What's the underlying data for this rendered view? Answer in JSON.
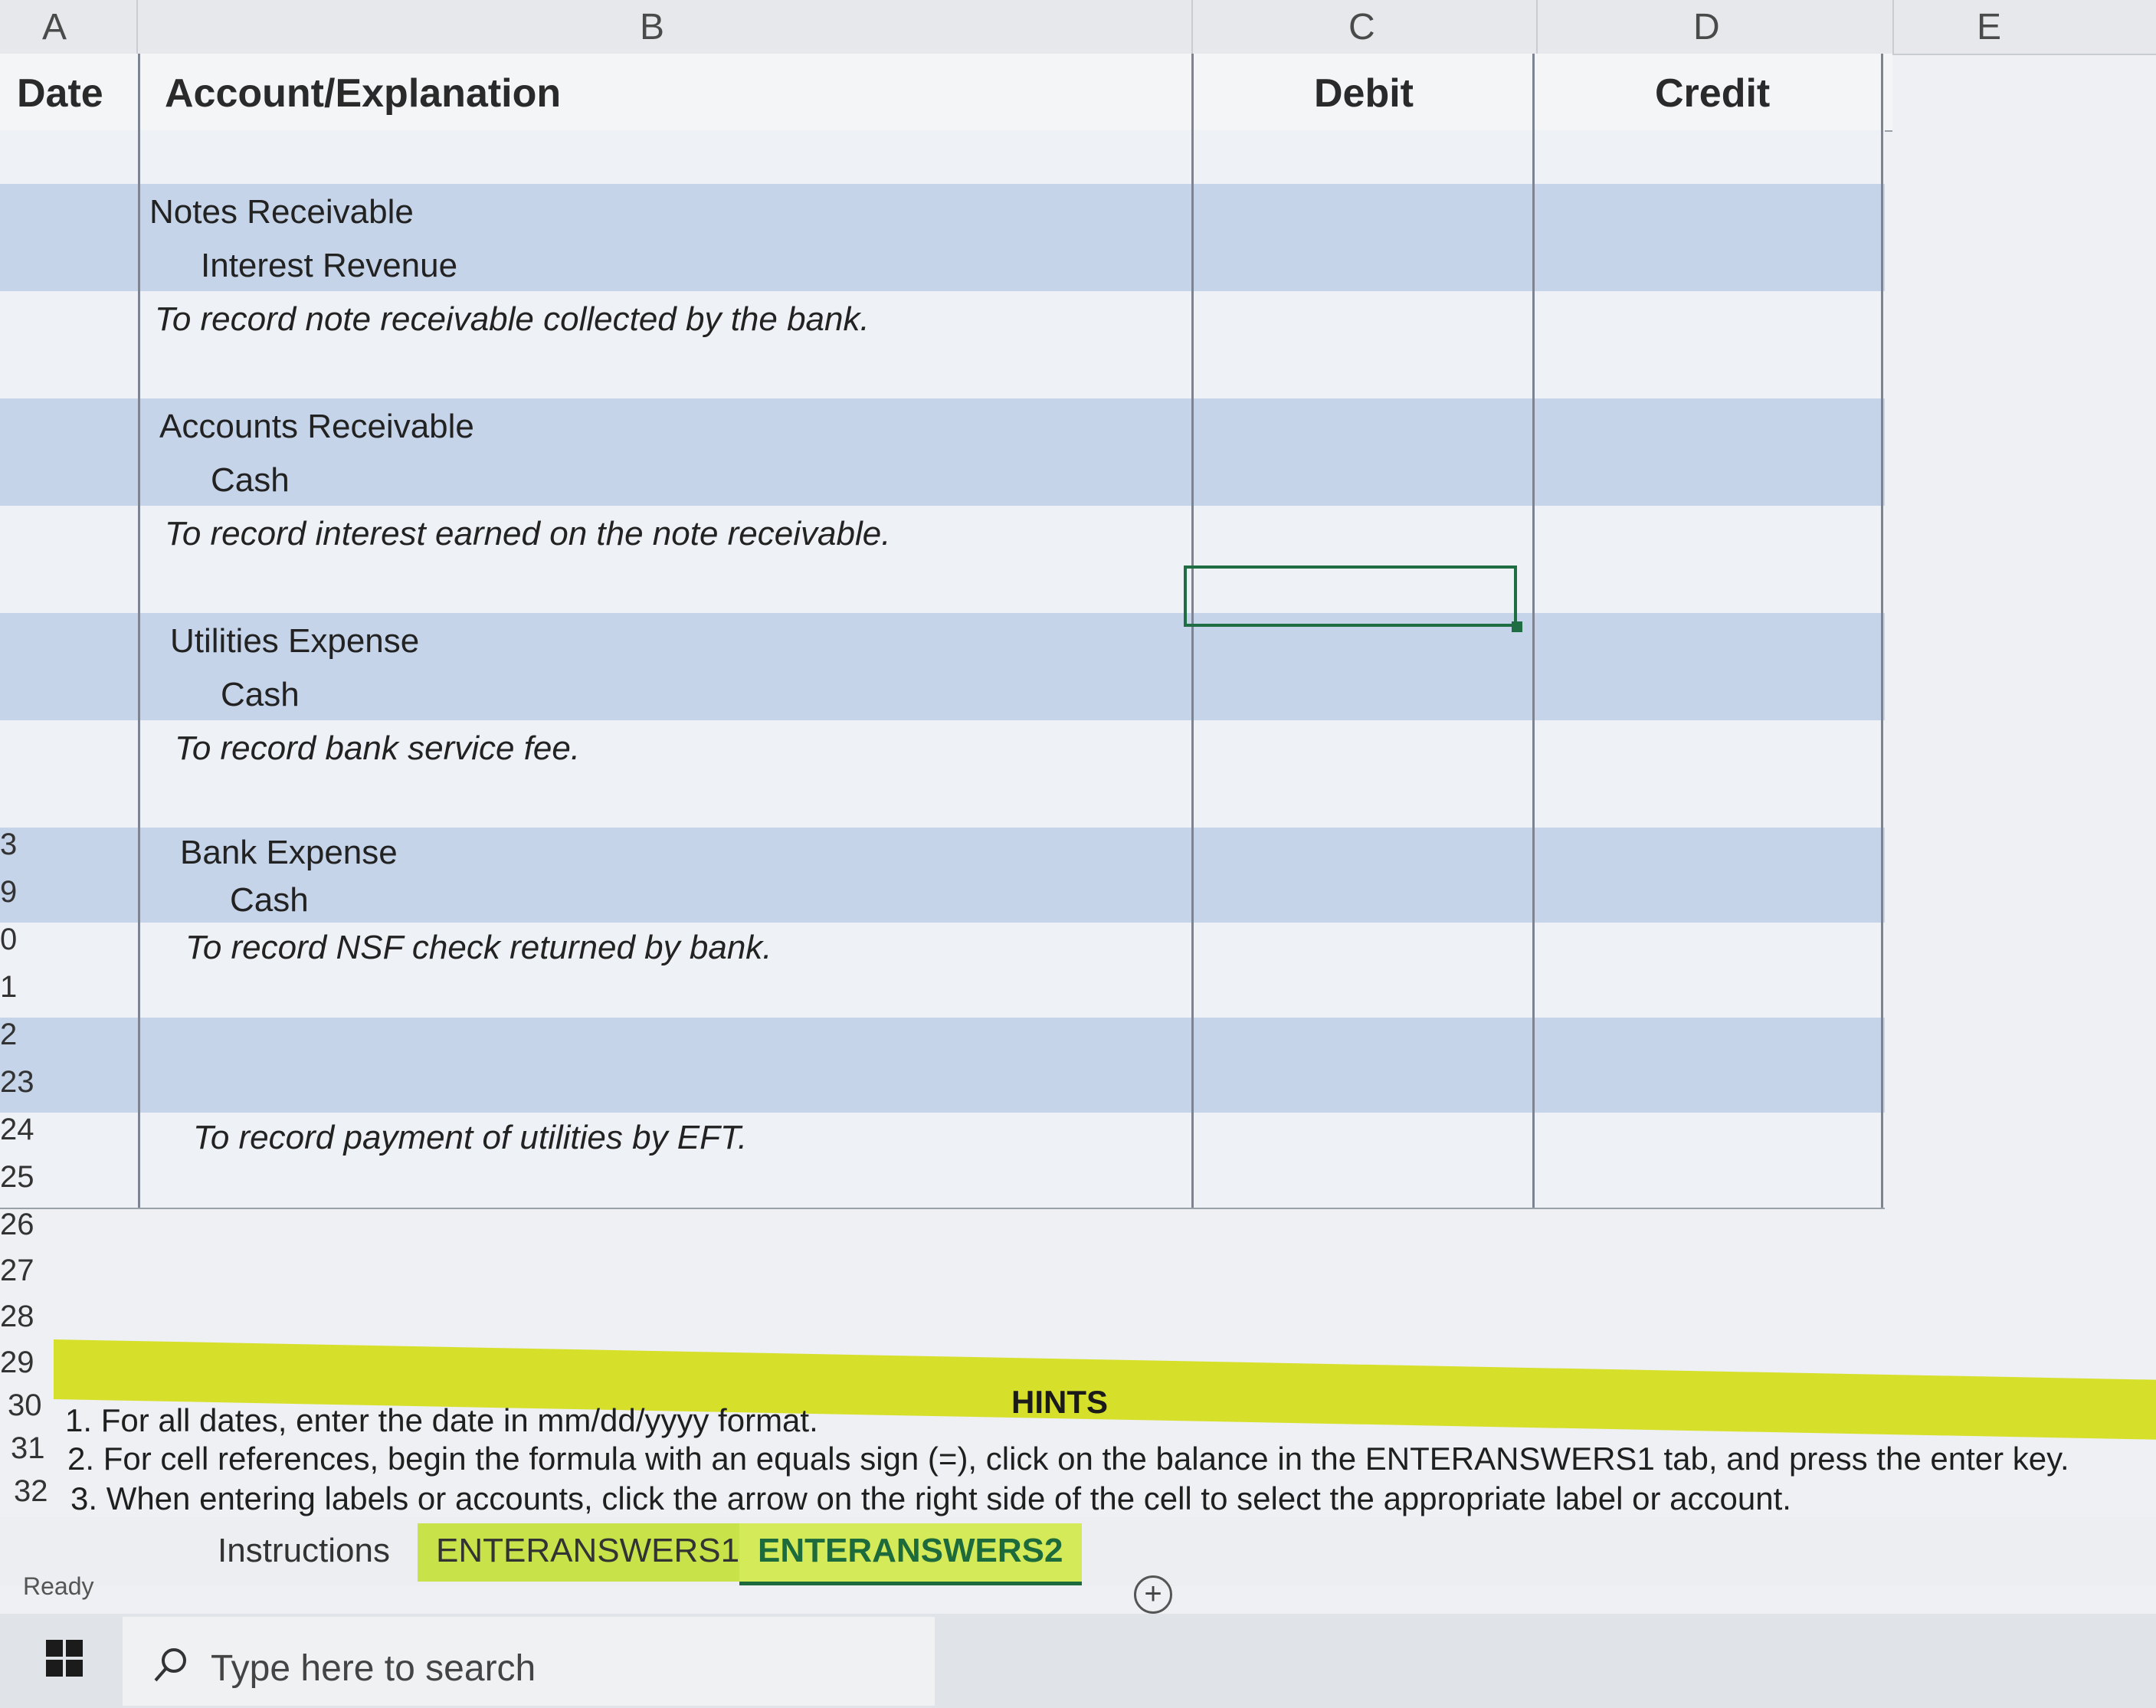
{
  "columns": {
    "a": "A",
    "b": "B",
    "c": "C",
    "d": "D",
    "e": "E"
  },
  "headers": {
    "date": "Date",
    "account": "Account/Explanation",
    "debit": "Debit",
    "credit": "Credit"
  },
  "entries": [
    {
      "debit_account": "Notes Receivable",
      "credit_account": "Interest Revenue",
      "explanation": "To record note receivable collected by the bank."
    },
    {
      "debit_account": "Accounts Receivable",
      "credit_account": "Cash",
      "explanation": "To record interest earned on the note receivable."
    },
    {
      "debit_account": "Utilities Expense",
      "credit_account": "Cash",
      "explanation": "To record bank service fee."
    },
    {
      "debit_account": "Bank Expense",
      "credit_account": "Cash",
      "explanation": "To record NSF check returned by bank."
    },
    {
      "debit_account": "",
      "credit_account": "",
      "explanation": "To record payment of utilities by EFT."
    }
  ],
  "row_numbers": [
    "3",
    "9",
    "0",
    "1",
    "2",
    "23",
    "24",
    "25",
    "26",
    "27",
    "28",
    "29",
    "30",
    "31",
    "32"
  ],
  "hints": {
    "title": "HINTS",
    "items": [
      "1. For all dates, enter the date in mm/dd/yyyy format.",
      "2. For cell references, begin the formula with an equals sign (=), click on the balance in the ENTERANSWERS1 tab, and press the enter key.",
      "3. When entering labels or accounts, click the arrow on the right side of the cell to select the appropriate label or account."
    ]
  },
  "tabs": [
    "Instructions",
    "ENTERANSWERS1",
    "ENTERANSWERS2"
  ],
  "active_tab": "ENTERANSWERS2",
  "status": "Ready",
  "taskbar": {
    "search_placeholder": "Type here to search"
  },
  "colors": {
    "shade": "#c5d4e8",
    "hint": "#d6e02a",
    "active_tab_text": "#1d6b3c"
  }
}
